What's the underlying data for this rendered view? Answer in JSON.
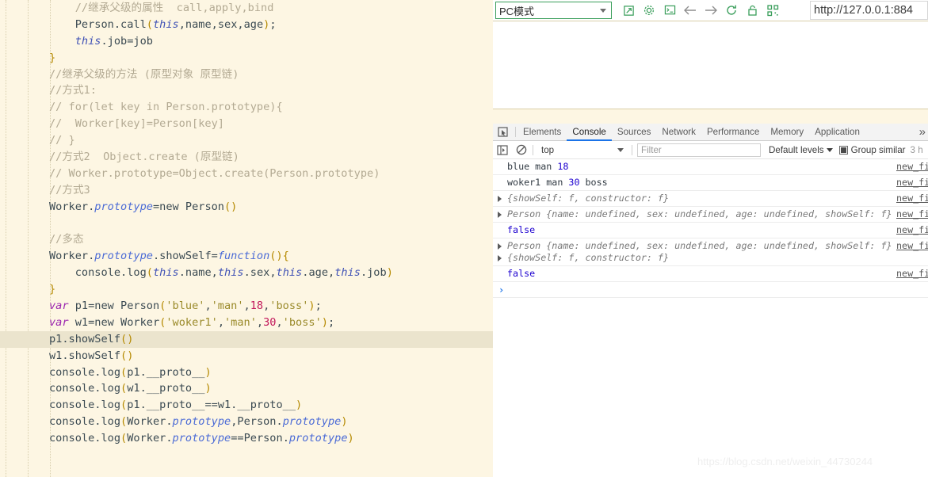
{
  "editor": {
    "highlighted_line_index": 20,
    "lines": [
      {
        "tokens": [
          {
            "t": "    ",
            "c": "punc"
          },
          {
            "t": "//继承父级的属性  call,apply,bind",
            "c": "cmt"
          }
        ]
      },
      {
        "tokens": [
          {
            "t": "    ",
            "c": "punc"
          },
          {
            "t": "Person",
            "c": "id"
          },
          {
            "t": ".",
            "c": "punc"
          },
          {
            "t": "call",
            "c": "id"
          },
          {
            "t": "(",
            "c": "brc"
          },
          {
            "t": "this",
            "c": "this"
          },
          {
            "t": ",name,sex,age",
            "c": "id"
          },
          {
            "t": ")",
            "c": "brc"
          },
          {
            "t": ";",
            "c": "punc"
          }
        ]
      },
      {
        "tokens": [
          {
            "t": "    ",
            "c": "punc"
          },
          {
            "t": "this",
            "c": "this"
          },
          {
            "t": ".job=job",
            "c": "id"
          }
        ]
      },
      {
        "tokens": [
          {
            "t": "}",
            "c": "brc"
          }
        ]
      },
      {
        "tokens": [
          {
            "t": "//继承父级的方法 (原型对象 原型链)",
            "c": "cmt"
          }
        ]
      },
      {
        "tokens": [
          {
            "t": "//方式1:",
            "c": "cmt"
          }
        ]
      },
      {
        "tokens": [
          {
            "t": "// for(let key in Person.prototype){",
            "c": "cmt"
          }
        ]
      },
      {
        "tokens": [
          {
            "t": "//  Worker[key]=Person[key]",
            "c": "cmt"
          }
        ]
      },
      {
        "tokens": [
          {
            "t": "// }",
            "c": "cmt"
          }
        ]
      },
      {
        "tokens": [
          {
            "t": "//方式2  Object.create (原型链)",
            "c": "cmt"
          }
        ]
      },
      {
        "tokens": [
          {
            "t": "// Worker.prototype=Object.create(Person.prototype)",
            "c": "cmt"
          }
        ]
      },
      {
        "tokens": [
          {
            "t": "//方式3",
            "c": "cmt"
          }
        ]
      },
      {
        "tokens": [
          {
            "t": "Worker",
            "c": "id"
          },
          {
            "t": ".",
            "c": "punc"
          },
          {
            "t": "prototype",
            "c": "proto"
          },
          {
            "t": "=new Person",
            "c": "id"
          },
          {
            "t": "()",
            "c": "brc"
          }
        ]
      },
      {
        "tokens": []
      },
      {
        "tokens": [
          {
            "t": "//多态",
            "c": "cmt"
          }
        ]
      },
      {
        "tokens": [
          {
            "t": "Worker",
            "c": "id"
          },
          {
            "t": ".",
            "c": "punc"
          },
          {
            "t": "prototype",
            "c": "proto"
          },
          {
            "t": ".showSelf=",
            "c": "id"
          },
          {
            "t": "function",
            "c": "fn"
          },
          {
            "t": "(){",
            "c": "brc"
          }
        ]
      },
      {
        "tokens": [
          {
            "t": "    ",
            "c": "punc"
          },
          {
            "t": "console",
            "c": "id"
          },
          {
            "t": ".",
            "c": "punc"
          },
          {
            "t": "log",
            "c": "id"
          },
          {
            "t": "(",
            "c": "brc"
          },
          {
            "t": "this",
            "c": "this"
          },
          {
            "t": ".name,",
            "c": "id"
          },
          {
            "t": "this",
            "c": "this"
          },
          {
            "t": ".sex,",
            "c": "id"
          },
          {
            "t": "this",
            "c": "this"
          },
          {
            "t": ".age,",
            "c": "id"
          },
          {
            "t": "this",
            "c": "this"
          },
          {
            "t": ".job",
            "c": "id"
          },
          {
            "t": ")",
            "c": "brc"
          }
        ]
      },
      {
        "tokens": [
          {
            "t": "}",
            "c": "brc"
          }
        ]
      },
      {
        "tokens": [
          {
            "t": "var",
            "c": "kw"
          },
          {
            "t": " p1=new Person",
            "c": "id"
          },
          {
            "t": "(",
            "c": "brc"
          },
          {
            "t": "'blue'",
            "c": "str"
          },
          {
            "t": ",",
            "c": "punc"
          },
          {
            "t": "'man'",
            "c": "str"
          },
          {
            "t": ",",
            "c": "punc"
          },
          {
            "t": "18",
            "c": "num"
          },
          {
            "t": ",",
            "c": "punc"
          },
          {
            "t": "'boss'",
            "c": "str"
          },
          {
            "t": ")",
            "c": "brc"
          },
          {
            "t": ";",
            "c": "punc"
          }
        ]
      },
      {
        "tokens": [
          {
            "t": "var",
            "c": "kw"
          },
          {
            "t": " w1=new Worker",
            "c": "id"
          },
          {
            "t": "(",
            "c": "brc"
          },
          {
            "t": "'woker1'",
            "c": "str"
          },
          {
            "t": ",",
            "c": "punc"
          },
          {
            "t": "'man'",
            "c": "str"
          },
          {
            "t": ",",
            "c": "punc"
          },
          {
            "t": "30",
            "c": "num"
          },
          {
            "t": ",",
            "c": "punc"
          },
          {
            "t": "'boss'",
            "c": "str"
          },
          {
            "t": ")",
            "c": "brc"
          },
          {
            "t": ";",
            "c": "punc"
          }
        ]
      },
      {
        "tokens": [
          {
            "t": "p1.showSelf",
            "c": "id"
          },
          {
            "t": "()",
            "c": "brc"
          }
        ]
      },
      {
        "tokens": [
          {
            "t": "w1.showSelf",
            "c": "id"
          },
          {
            "t": "()",
            "c": "brc"
          }
        ]
      },
      {
        "tokens": [
          {
            "t": "console",
            "c": "id"
          },
          {
            "t": ".",
            "c": "punc"
          },
          {
            "t": "log",
            "c": "id"
          },
          {
            "t": "(",
            "c": "brc"
          },
          {
            "t": "p1.__proto__",
            "c": "id"
          },
          {
            "t": ")",
            "c": "brc"
          }
        ]
      },
      {
        "tokens": [
          {
            "t": "console",
            "c": "id"
          },
          {
            "t": ".",
            "c": "punc"
          },
          {
            "t": "log",
            "c": "id"
          },
          {
            "t": "(",
            "c": "brc"
          },
          {
            "t": "w1.__proto__",
            "c": "id"
          },
          {
            "t": ")",
            "c": "brc"
          }
        ]
      },
      {
        "tokens": [
          {
            "t": "console",
            "c": "id"
          },
          {
            "t": ".",
            "c": "punc"
          },
          {
            "t": "log",
            "c": "id"
          },
          {
            "t": "(",
            "c": "brc"
          },
          {
            "t": "p1.__proto__==w1.__proto__",
            "c": "id"
          },
          {
            "t": ")",
            "c": "brc"
          }
        ]
      },
      {
        "tokens": [
          {
            "t": "console",
            "c": "id"
          },
          {
            "t": ".",
            "c": "punc"
          },
          {
            "t": "log",
            "c": "id"
          },
          {
            "t": "(",
            "c": "brc"
          },
          {
            "t": "Worker",
            "c": "id"
          },
          {
            "t": ".",
            "c": "punc"
          },
          {
            "t": "prototype",
            "c": "proto"
          },
          {
            "t": ",Person",
            "c": "id"
          },
          {
            "t": ".",
            "c": "punc"
          },
          {
            "t": "prototype",
            "c": "proto"
          },
          {
            "t": ")",
            "c": "brc"
          }
        ]
      },
      {
        "tokens": [
          {
            "t": "console",
            "c": "id"
          },
          {
            "t": ".",
            "c": "punc"
          },
          {
            "t": "log",
            "c": "id"
          },
          {
            "t": "(",
            "c": "brc"
          },
          {
            "t": "Worker",
            "c": "id"
          },
          {
            "t": ".",
            "c": "punc"
          },
          {
            "t": "prototype",
            "c": "proto"
          },
          {
            "t": "==Person",
            "c": "id"
          },
          {
            "t": ".",
            "c": "punc"
          },
          {
            "t": "prototype",
            "c": "proto"
          },
          {
            "t": ")",
            "c": "brc"
          }
        ]
      }
    ]
  },
  "device_toolbar": {
    "device_label": "PC模式",
    "icons": [
      "open-in-new-icon",
      "gear-icon",
      "console-drawer-icon",
      "back-arrow-icon",
      "forward-arrow-icon",
      "reload-icon",
      "lock-icon",
      "qr-code-icon"
    ],
    "url": "http://127.0.0.1:884"
  },
  "devtools": {
    "tabs": [
      {
        "label": "Elements",
        "active": false
      },
      {
        "label": "Console",
        "active": true
      },
      {
        "label": "Sources",
        "active": false
      },
      {
        "label": "Network",
        "active": false
      },
      {
        "label": "Performance",
        "active": false
      },
      {
        "label": "Memory",
        "active": false
      },
      {
        "label": "Application",
        "active": false
      }
    ],
    "more_tabs": "»",
    "console_toolbar": {
      "context": "top",
      "filter_placeholder": "Filter",
      "levels_label": "Default levels",
      "group_similar_label": "Group similar",
      "group_similar_checked": true,
      "hidden_count": "3 h"
    },
    "log_rows": [
      {
        "kind": "text",
        "parts": [
          {
            "t": "blue man ",
            "c": "plain"
          },
          {
            "t": "18",
            "c": "num"
          }
        ],
        "source": "new_file."
      },
      {
        "kind": "text",
        "parts": [
          {
            "t": "woker1 man ",
            "c": "plain"
          },
          {
            "t": "30",
            "c": "num"
          },
          {
            "t": " boss",
            "c": "plain"
          }
        ],
        "source": "new_file."
      },
      {
        "kind": "object",
        "expandable": true,
        "text": "{showSelf: f, constructor: f}",
        "source": "new_file."
      },
      {
        "kind": "object",
        "expandable": true,
        "text": "Person {name: undefined, sex: undefined, age: undefined, showSelf: f}",
        "source": "new_file."
      },
      {
        "kind": "bool",
        "text": "false",
        "source": "new_file."
      },
      {
        "kind": "object-pair",
        "expandable": true,
        "text": "Person {name: undefined, sex: undefined, age: undefined, showSelf: f}",
        "text2": "{showSelf: f, constructor: f}",
        "source": "new_file."
      },
      {
        "kind": "bool",
        "text": "false",
        "source": "new_file."
      }
    ],
    "prompt_symbol": "›"
  },
  "watermark": "https://blog.csdn.net/weixin_44730244"
}
